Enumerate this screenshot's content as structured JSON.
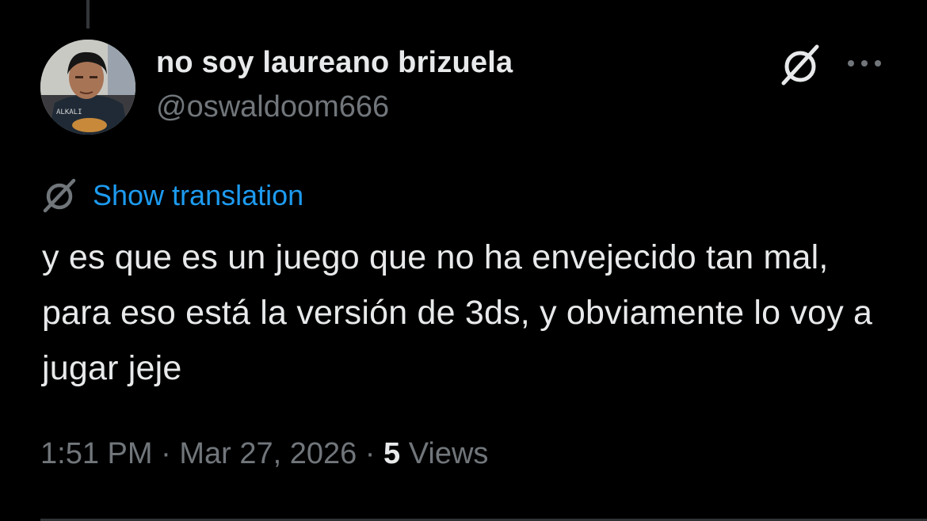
{
  "tweet": {
    "display_name": "no soy laureano brizuela",
    "handle": "@oswaldoom666",
    "translate_label": "Show translation",
    "text": "y es que es un juego que no ha envejecido tan mal, para eso está la versión de 3ds, y obviamente lo voy a jugar jeje",
    "time": "1:51 PM",
    "separator": " · ",
    "date": "Mar 27, 2026",
    "views_count": "5",
    "views_label": " Views"
  },
  "icons": {
    "avatar": "avatar",
    "grok": "grok-icon",
    "more": "more-icon",
    "translate": "translate-icon"
  },
  "colors": {
    "background": "#000000",
    "primary_text": "#e7e9ea",
    "secondary_text": "#71767b",
    "link": "#1d9bf0",
    "divider": "#2f3336"
  }
}
